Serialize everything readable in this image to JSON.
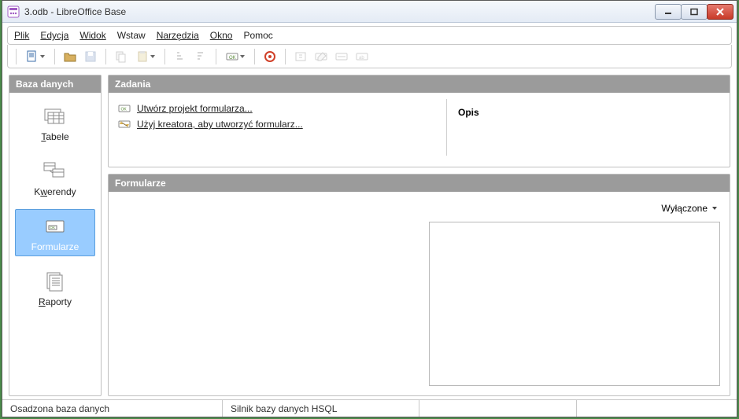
{
  "window": {
    "title": "3.odb - LibreOffice Base"
  },
  "menu": {
    "plik": "Plik",
    "edycja": "Edycja",
    "widok": "Widok",
    "wstaw": "Wstaw",
    "narzedzia": "Narzędzia",
    "okno": "Okno",
    "pomoc": "Pomoc"
  },
  "sidebar": {
    "header": "Baza danych",
    "tabele": "Tabele",
    "kwerendy": "Kwerendy",
    "formularze": "Formularze",
    "raporty": "Raporty"
  },
  "tasks": {
    "header": "Zadania",
    "create_form": "Utwórz projekt formularza...",
    "wizard_pre": "Użyj kreatora, ",
    "wizard_post": "aby utworzyć formularz...",
    "desc_title": "Opis"
  },
  "forms": {
    "header": "Formularze",
    "view_mode": "Wyłączone"
  },
  "status": {
    "embedded": "Osadzona baza danych",
    "engine": "Silnik bazy danych HSQL"
  },
  "colors": {
    "selection": "#99ccff"
  }
}
